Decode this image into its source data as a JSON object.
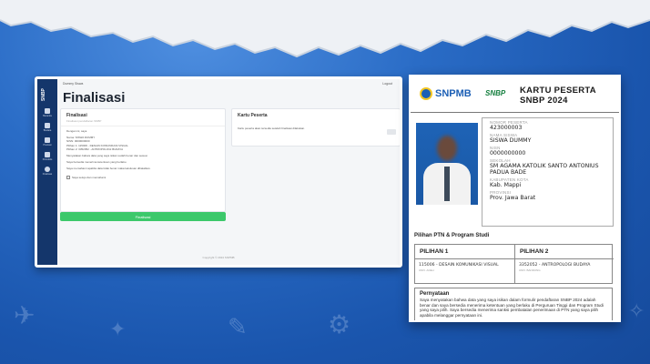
{
  "left_screen": {
    "brand": "SNBP",
    "user": "Dummy Siswa",
    "logout": "Logout",
    "page_title": "Finalisasi",
    "nav_items": [
      "Beranda",
      "Biodata",
      "Prestasi",
      "Portofolio",
      "Finalisasi"
    ],
    "finalisasi_panel": {
      "heading": "Finalisasi",
      "subheading": "Finalisasi pendaftaran SNBP",
      "lines": [
        "Dengan ini, saya",
        "",
        "Nama: SISWA DUMMY",
        "NISN: 0000000000",
        "Pilihan 1: 115006 - DESAIN KOMUNIKASI VISUAL",
        "Pilihan 2: 3352052 - ANTROPOLOGI BUDAYA",
        "",
        "Menyatakan bahwa data yang saya isikan sudah benar dan sesuai.",
        "",
        "Saya bersedia menerima ketentuan yang berlaku.",
        "",
        "Saya memahami apabila data tidak benar maka kelulusan dibatalkan."
      ],
      "agree_label": "Saya setuju dan memahami",
      "submit_label": "Finalisasi"
    },
    "kartu_panel": {
      "heading": "Kartu Peserta",
      "note": "Kartu peserta akan tersedia setelah finalisasi dilakukan."
    },
    "footer": "Copyright © 2024 SNPMB"
  },
  "card": {
    "logo_snpmb": "SNPMB",
    "logo_snbp": "SNBP",
    "title_line1": "KARTU PESERTA",
    "title_line2": "SNBP 2024",
    "fields": [
      {
        "label": "NOMOR PESERTA",
        "value": "423000003"
      },
      {
        "label": "NAMA SISWA",
        "value": "SISWA DUMMY"
      },
      {
        "label": "NISN",
        "value": "0000000000"
      },
      {
        "label": "SEKOLAH",
        "value": "SM AGAMA KATOLIK SANTO ANTONIUS PADUA BADE"
      },
      {
        "label": "KABUPATEN KOTA",
        "value": "Kab. Mappi"
      },
      {
        "label": "PROVINSI",
        "value": "Prov. Jawa Barat"
      }
    ],
    "pilihan_title": "Pilihan PTN & Program Studi",
    "pilihan": [
      {
        "header": "PILIHAN 1",
        "value": "115006 - DESAIN KOMUNIKASI VISUAL",
        "sub": "UNIV. ACEH"
      },
      {
        "header": "PILIHAN 2",
        "value": "3352052 - ANTROPOLOGI BUDAYA",
        "sub": "UNIV. BANDUNG"
      }
    ],
    "pernyataan_title": "Pernyataan",
    "pernyataan_text": "Saya menyatakan bahwa data yang saya isikan dalam formulir pendaftaran SNBP 2024 adalah benar dan saya bersedia menerima ketentuan yang berlaku di Perguruan Tinggi dan Program Studi yang saya pilih. Saya bersedia menerima sanksi pembatalan penerimaan di PTN yang saya pilih apabila melanggar pernyataan ini."
  },
  "colors": {
    "background": "#1e5fb8",
    "sidebar": "#14366b",
    "submit_button": "#3cc86b",
    "snpmb_blue": "#1c5fb5",
    "snbp_green": "#137e3d"
  }
}
